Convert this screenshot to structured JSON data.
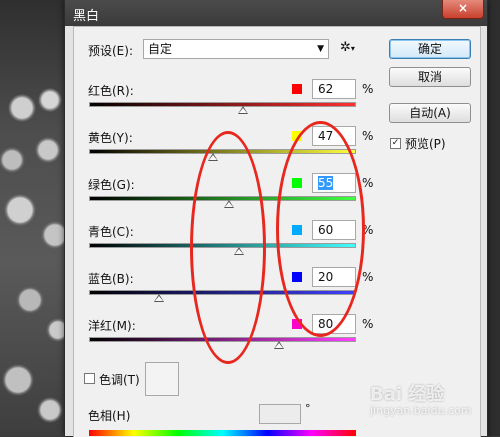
{
  "dialog": {
    "title": "黑白",
    "close_icon": "×"
  },
  "preset": {
    "label": "预设(E):",
    "value": "自定",
    "gear_icon": "✲"
  },
  "buttons": {
    "ok": "确定",
    "cancel": "取消",
    "auto": "自动(A)"
  },
  "preview": {
    "label": "预览(P)",
    "checked": true
  },
  "channels": [
    {
      "label": "红色(R):",
      "value": "62",
      "color": "#ff0000",
      "track_from": "#000000",
      "track_to": "#ff3030",
      "percent": 62
    },
    {
      "label": "黄色(Y):",
      "value": "47",
      "color": "#ffff00",
      "track_from": "#000000",
      "track_to": "#ffff40",
      "percent": 47
    },
    {
      "label": "绿色(G):",
      "value": "55",
      "color": "#00ff00",
      "track_from": "#000000",
      "track_to": "#40ff40",
      "percent": 55
    },
    {
      "label": "青色(C):",
      "value": "60",
      "color": "#00aaff",
      "track_from": "#000000",
      "track_to": "#40ffff",
      "percent": 60
    },
    {
      "label": "蓝色(B):",
      "value": "20",
      "color": "#0000ff",
      "track_from": "#000000",
      "track_to": "#4040ff",
      "percent": 20
    },
    {
      "label": "洋红(M):",
      "value": "80",
      "color": "#ff00cc",
      "track_from": "#000000",
      "track_to": "#ff40ff",
      "percent": 80
    }
  ],
  "percent_sign": "%",
  "tint": {
    "label": "色调(T)",
    "checked": false
  },
  "hue": {
    "label": "色相(H)",
    "degree_sign": "°"
  },
  "watermark": {
    "text": "Bai 经验",
    "sub": "jingyan.baidu.com"
  }
}
